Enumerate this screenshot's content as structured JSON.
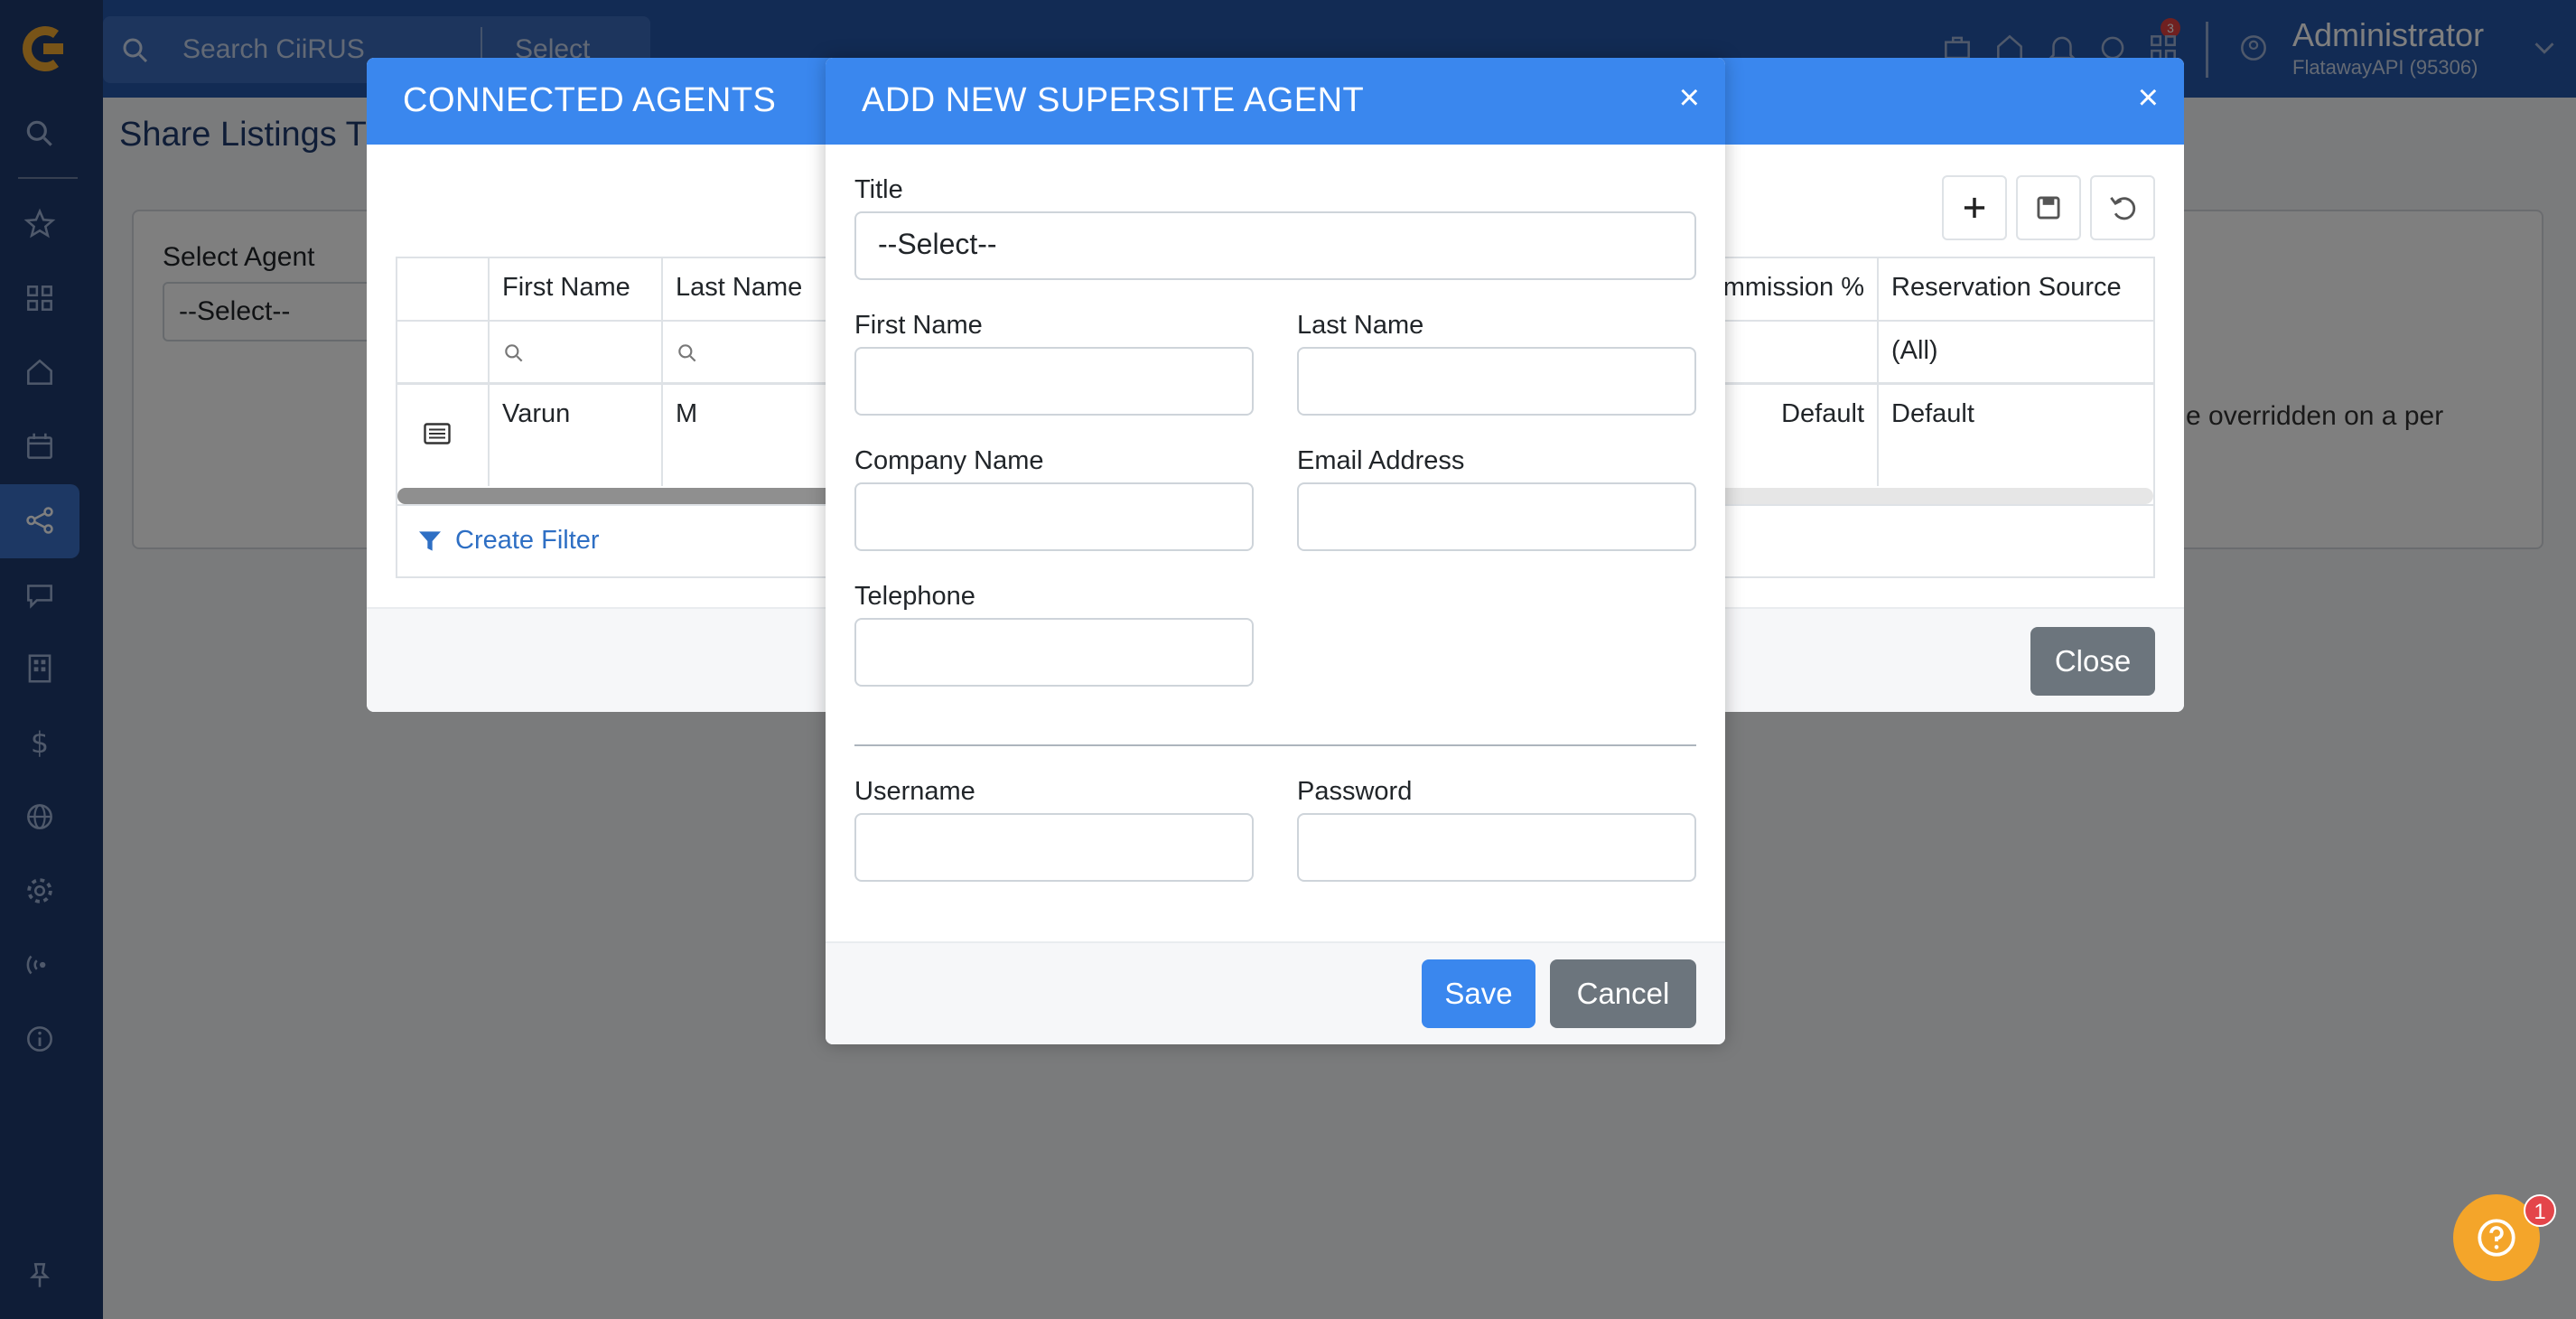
{
  "topbar": {
    "search_placeholder": "Search CiiRUS",
    "select_label": "Select",
    "notification_count": "3",
    "user_name": "Administrator",
    "user_account": "FlatawayAPI (95306)"
  },
  "page": {
    "title": "Share Listings T",
    "select_agent_label": "Select Agent",
    "select_agent_value": "--Select--",
    "override_text": "e overridden on a per"
  },
  "connected_agents": {
    "title": "CONNECTED AGENTS",
    "close_symbol": "×",
    "columns": {
      "first_name": "First Name",
      "last_name": "Last Name",
      "commission": "mmission %",
      "reservation_source": "Reservation Source"
    },
    "filter_reservation_source": "(All)",
    "rows": [
      {
        "first_name": "Varun",
        "last_name": "M",
        "commission": "Default",
        "reservation_source": "Default"
      }
    ],
    "create_filter_label": "Create Filter",
    "close_label": "Close"
  },
  "add_agent": {
    "title": "ADD NEW SUPERSITE AGENT",
    "close_symbol": "×",
    "title_label": "Title",
    "title_value": "--Select--",
    "first_name_label": "First Name",
    "last_name_label": "Last Name",
    "company_name_label": "Company Name",
    "email_label": "Email Address",
    "telephone_label": "Telephone",
    "username_label": "Username",
    "password_label": "Password",
    "save_label": "Save",
    "cancel_label": "Cancel"
  },
  "help": {
    "badge_count": "1"
  },
  "colors": {
    "modal_header": "#3a87ee",
    "sidebar": "#1f3b6e",
    "topbar": "#2556a8",
    "secondary_button": "#6c757d",
    "help_button": "#f4a52a"
  }
}
